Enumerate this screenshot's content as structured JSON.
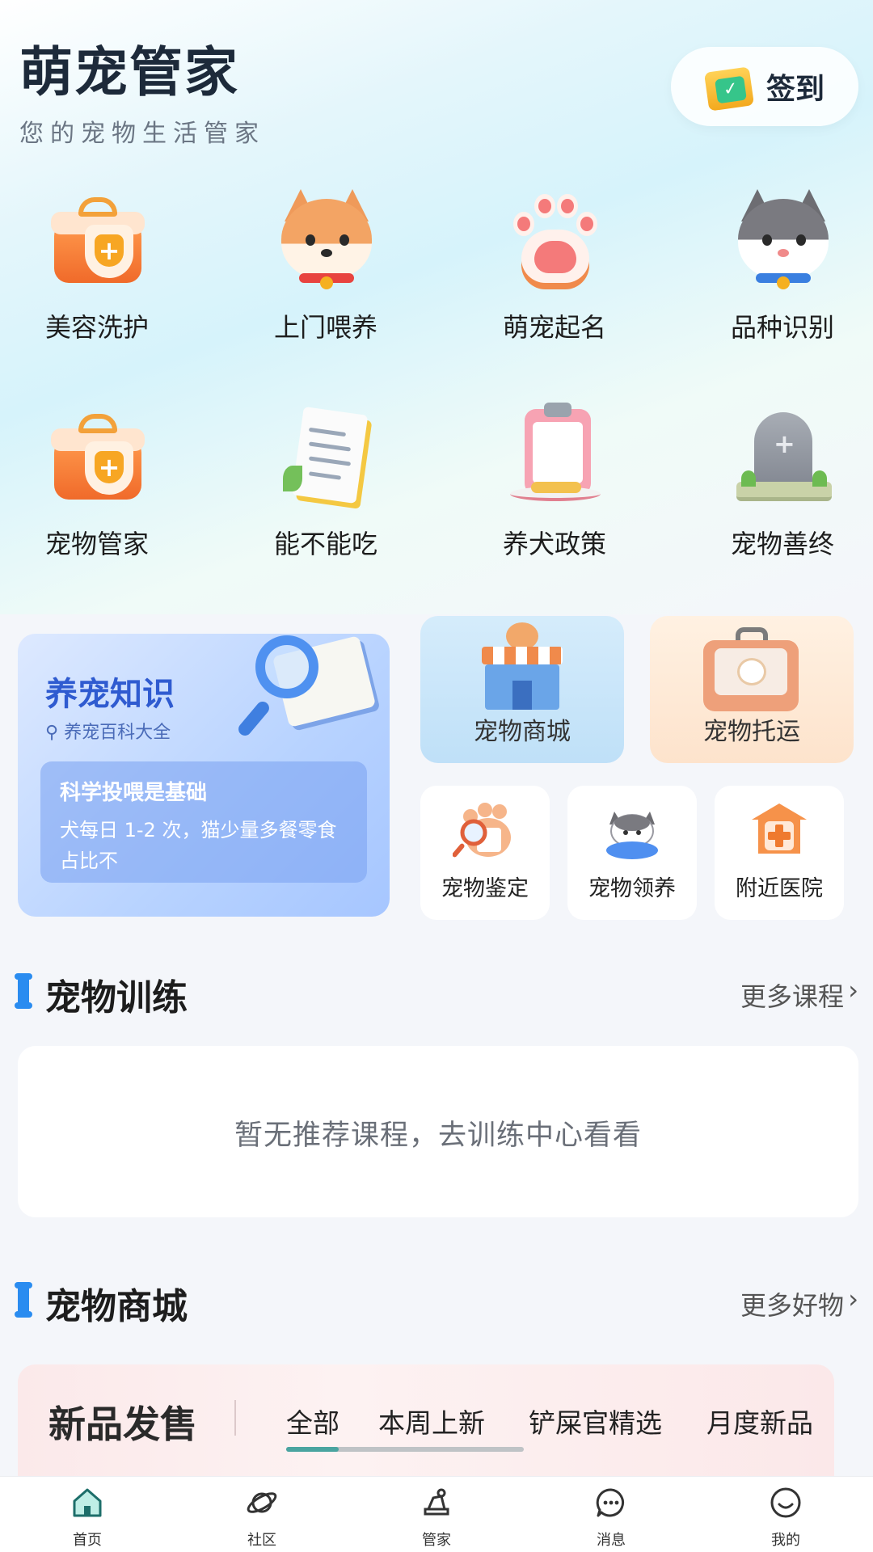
{
  "header": {
    "title": "萌宠管家",
    "subtitle": "您的宠物生活管家",
    "checkin_label": "签到"
  },
  "features": [
    {
      "label": "美容洗护",
      "icon": "gift-shield-icon"
    },
    {
      "label": "上门喂养",
      "icon": "shiba-dog-icon"
    },
    {
      "label": "萌宠起名",
      "icon": "paw-icon"
    },
    {
      "label": "品种识别",
      "icon": "cat-face-icon"
    },
    {
      "label": "宠物管家",
      "icon": "gift-shield-icon"
    },
    {
      "label": "能不能吃",
      "icon": "document-icon"
    },
    {
      "label": "养犬政策",
      "icon": "clipboard-icon"
    },
    {
      "label": "宠物善终",
      "icon": "tombstone-icon"
    }
  ],
  "knowledge": {
    "title": "养宠知识",
    "search_hint": "养宠百科大全",
    "tip_title": "科学投喂是基础",
    "tip_body": "犬每日 1-2 次，猫少量多餐零食占比不"
  },
  "services": {
    "mall": "宠物商城",
    "transport": "宠物托运",
    "appraisal": "宠物鉴定",
    "adoption": "宠物领养",
    "hospital": "附近医院"
  },
  "training": {
    "title": "宠物训练",
    "more": "更多课程",
    "empty_text": "暂无推荐课程，去训练中心看看"
  },
  "shop": {
    "title": "宠物商城",
    "more": "更多好物",
    "banner_title": "新品发售",
    "tabs": [
      "全部",
      "本周上新",
      "铲屎官精选",
      "月度新品"
    ],
    "scroll_progress": 0.22
  },
  "tabbar": [
    {
      "label": "首页",
      "icon": "home-icon",
      "active": true
    },
    {
      "label": "社区",
      "icon": "planet-icon",
      "active": false
    },
    {
      "label": "管家",
      "icon": "butler-icon",
      "active": false
    },
    {
      "label": "消息",
      "icon": "message-icon",
      "active": false
    },
    {
      "label": "我的",
      "icon": "smile-icon",
      "active": false
    }
  ],
  "colors": {
    "accent": "#2a8cf0",
    "knowledge_title": "#2f5bd0",
    "tab_active": "#3bb3b0"
  }
}
